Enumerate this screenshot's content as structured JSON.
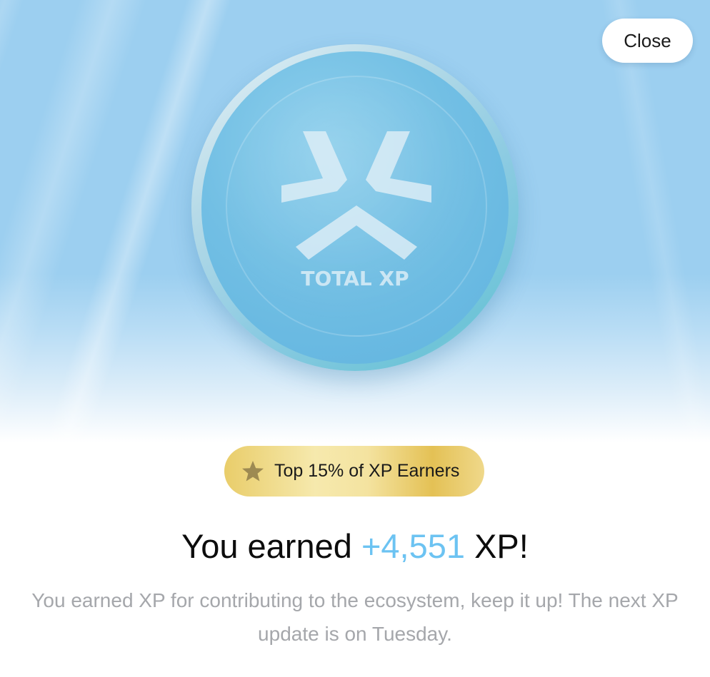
{
  "close_button": {
    "label": "Close"
  },
  "coin": {
    "icon": "total-xp-logo",
    "label": "TOTAL XP"
  },
  "badge": {
    "icon": "star-icon",
    "text": "Top 15% of XP Earners"
  },
  "headline": {
    "prefix": "You earned",
    "amount": "+4,551",
    "suffix": "XP!"
  },
  "description": "You earned XP for contributing to the ecosystem, keep it up! The next XP update is on Tuesday.",
  "colors": {
    "hero_sky": "#9ccff0",
    "xp_accent": "#6cc3f2",
    "badge_gold": "#e9cd6a",
    "description_gray": "#a5a7ab"
  }
}
